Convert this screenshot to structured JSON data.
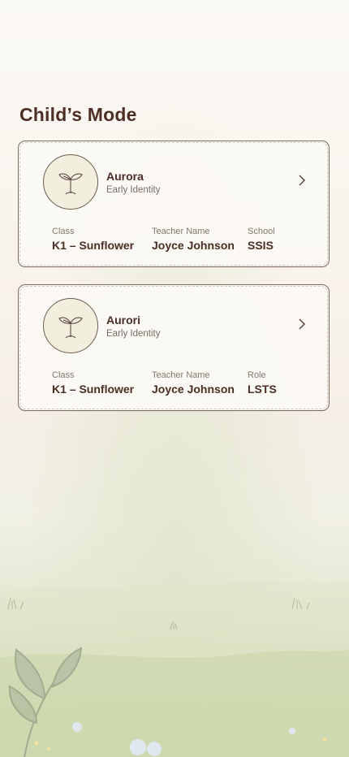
{
  "page": {
    "title": "Child’s Mode"
  },
  "children": [
    {
      "name": "Aurora",
      "program": "Early Identity",
      "fields": [
        {
          "label": "Class",
          "value": "K1 – Sunflower"
        },
        {
          "label": "Teacher Name",
          "value": "Joyce Johnson"
        },
        {
          "label": "School",
          "value": "SSIS"
        }
      ]
    },
    {
      "name": "Aurori",
      "program": "Early Identity",
      "fields": [
        {
          "label": "Class",
          "value": "K1 – Sunflower"
        },
        {
          "label": "Teacher Name",
          "value": "Joyce Johnson"
        },
        {
          "label": "Role",
          "value": "LSTS"
        }
      ]
    }
  ],
  "icons": {
    "avatar": "sprout-icon",
    "open": "chevron-right-icon"
  },
  "colors": {
    "text_primary": "#4a2e24",
    "text_secondary": "#7a6a63",
    "card_border": "#7f6a62",
    "avatar_bg": "#f3efdf"
  }
}
